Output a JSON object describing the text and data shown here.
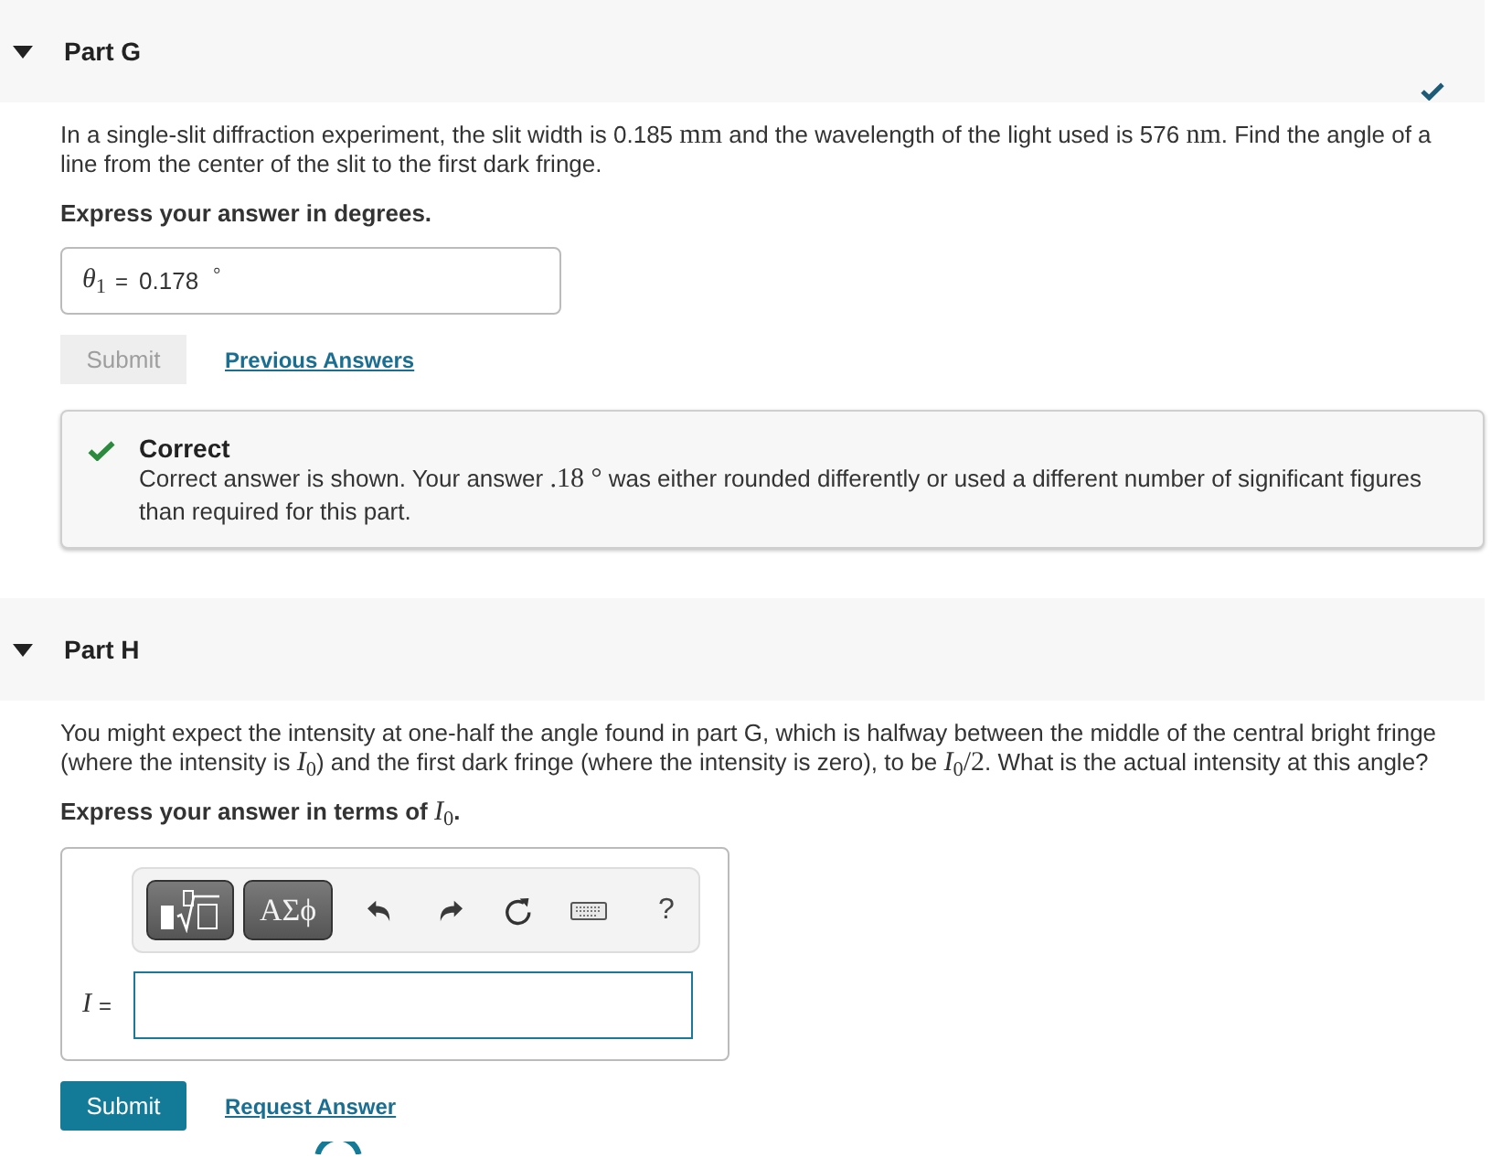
{
  "parts": [
    {
      "title": "Part G",
      "expanded": true,
      "completed": true,
      "question": [
        {
          "kind": "text",
          "text": "In a single-slit diffraction experiment, the slit width is 0.185 "
        },
        {
          "kind": "math",
          "text": "mm"
        },
        {
          "kind": "text",
          "text": " and the wavelength of the light used is 576 "
        },
        {
          "kind": "math",
          "text": "nm"
        },
        {
          "kind": "text",
          "text": ". Find the angle of a line from the center of the slit to the first dark fringe."
        }
      ],
      "instruction": [
        {
          "kind": "text",
          "text": "Express your answer in degrees."
        }
      ],
      "answer": {
        "kind": "value",
        "variable": "*θ*$_{1}$",
        "equals": "=",
        "value": "0.178",
        "unit": "°"
      },
      "submit": {
        "label": "Submit",
        "disabled": true
      },
      "link": "Previous Answers",
      "feedback": {
        "kind": "correct",
        "title": "Correct",
        "message": [
          {
            "kind": "text",
            "text": "Correct answer is shown. Your answer "
          },
          {
            "kind": "math",
            "text": ".18 °"
          },
          {
            "kind": "text",
            "text": " was either rounded differently or used a different number of significant figures than required for this part."
          }
        ]
      }
    },
    {
      "title": "Part H",
      "expanded": true,
      "completed": false,
      "question": [
        {
          "kind": "text",
          "text": "You might expect the intensity at one-half the angle found in part G, which is halfway between the middle of the central bright fringe (where the intensity is "
        },
        {
          "kind": "math",
          "text": "*I*$_{0}$"
        },
        {
          "kind": "text",
          "text": ") and the first dark fringe (where the intensity is zero), to be "
        },
        {
          "kind": "math",
          "text": "*I*$_{0}$/2"
        },
        {
          "kind": "text",
          "text": ". What is the actual intensity at this angle?"
        }
      ],
      "instruction": [
        {
          "kind": "text",
          "text": "Express your answer in terms of "
        },
        {
          "kind": "math",
          "text": "*I*$_{0}$"
        },
        {
          "kind": "text",
          "text": "."
        }
      ],
      "answer": {
        "kind": "editor",
        "toolbar": [
          {
            "kind": "templates"
          },
          {
            "kind": "symbols",
            "label": "ΑΣϕ"
          },
          {
            "kind": "undo"
          },
          {
            "kind": "redo"
          },
          {
            "kind": "reset"
          },
          {
            "kind": "keyboard"
          },
          {
            "kind": "help",
            "label": "?"
          }
        ],
        "variable": "*I*",
        "equals": "="
      },
      "submit": {
        "label": "Submit",
        "disabled": false
      },
      "link": "Request Answer"
    }
  ]
}
